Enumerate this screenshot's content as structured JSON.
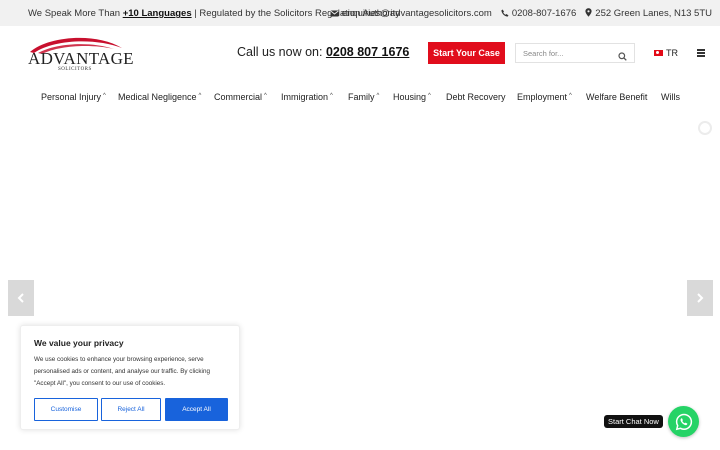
{
  "topbar": {
    "speak_prefix": "We Speak More Than ",
    "languages_link": "+10 Languages",
    "regulated": " | Regulated by the Solicitors Regulation Authority",
    "email": "enquiries@advantagesolicitors.com",
    "phone": "0208-807-1676",
    "address": "252 Green Lanes, N13 5TU"
  },
  "logo": {
    "word": "ADVANTAGE",
    "sub": "SOLICITORS",
    "colors": {
      "swoosh": "#c8102e",
      "text": "#222222"
    }
  },
  "header": {
    "call_label": "Call us now on: ",
    "call_number": "0208 807 1676",
    "cta_label": "Start Your Case",
    "search_placeholder": "Search for...",
    "language": "TR"
  },
  "nav": {
    "items": [
      {
        "label": "Personal Injury",
        "dropdown": true
      },
      {
        "label": "Medical Negligence",
        "dropdown": true
      },
      {
        "label": "Commercial",
        "dropdown": true
      },
      {
        "label": "Immigration",
        "dropdown": true
      },
      {
        "label": "Family",
        "dropdown": true
      },
      {
        "label": "Housing",
        "dropdown": true
      },
      {
        "label": "Debt Recovery",
        "dropdown": false
      },
      {
        "label": "Employment",
        "dropdown": true
      },
      {
        "label": "Welfare Benefit",
        "dropdown": false
      },
      {
        "label": "Wills",
        "dropdown": false
      }
    ]
  },
  "slider": {
    "prev_icon": "chevron-left-icon",
    "next_icon": "chevron-right-icon"
  },
  "cookie": {
    "title": "We value your privacy",
    "text": "We use cookies to enhance your browsing experience, serve personalised ads or content, and analyse our traffic. By clicking \"Accept All\", you consent to our use of cookies.",
    "customise": "Customise",
    "reject": "Reject All",
    "accept": "Accept All",
    "accent": "#1863dc"
  },
  "chat": {
    "label": "Start Chat Now",
    "icon": "whatsapp-icon",
    "color": "#25d366"
  },
  "colors": {
    "brand_red": "#e10d1c",
    "topbar_bg": "#f1f1f1"
  }
}
